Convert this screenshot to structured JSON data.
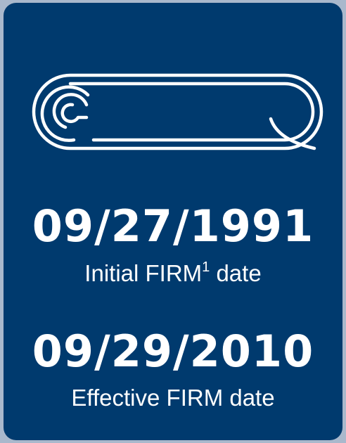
{
  "icon": "scroll-icon",
  "colors": {
    "card_background": "#003a6e",
    "text": "#ffffff",
    "page_background": "#a9b8cc"
  },
  "items": [
    {
      "date": "09/27/1991",
      "label_prefix": "Initial FIRM",
      "label_superscript": "1",
      "label_suffix": " date"
    },
    {
      "date": "09/29/2010",
      "label": "Effective FIRM date"
    }
  ]
}
